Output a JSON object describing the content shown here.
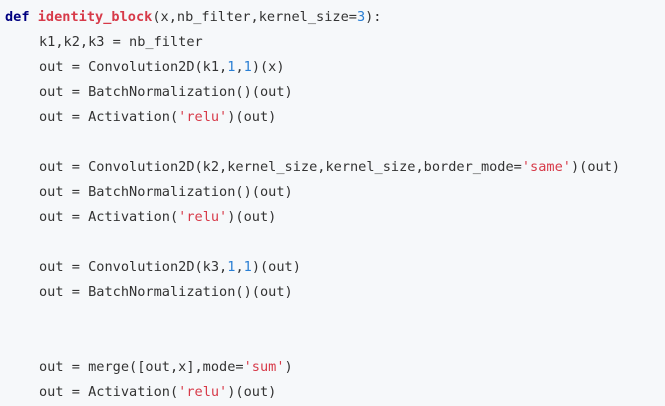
{
  "code": {
    "lines": [
      {
        "indent": false,
        "tokens": [
          {
            "t": "kw",
            "s": "def"
          },
          {
            "t": "plain",
            "s": " "
          },
          {
            "t": "fn",
            "s": "identity_block"
          },
          {
            "t": "plain",
            "s": "(x,nb_filter,kernel_size="
          },
          {
            "t": "num",
            "s": "3"
          },
          {
            "t": "plain",
            "s": "):"
          }
        ]
      },
      {
        "indent": true,
        "tokens": [
          {
            "t": "plain",
            "s": "k1,k2,k3 = nb_filter"
          }
        ]
      },
      {
        "indent": true,
        "tokens": [
          {
            "t": "plain",
            "s": "out = Convolution2D(k1,"
          },
          {
            "t": "num",
            "s": "1"
          },
          {
            "t": "plain",
            "s": ","
          },
          {
            "t": "num",
            "s": "1"
          },
          {
            "t": "plain",
            "s": ")(x)"
          }
        ]
      },
      {
        "indent": true,
        "tokens": [
          {
            "t": "plain",
            "s": "out = BatchNormalization()(out)"
          }
        ]
      },
      {
        "indent": true,
        "tokens": [
          {
            "t": "plain",
            "s": "out = Activation("
          },
          {
            "t": "str",
            "s": "'relu'"
          },
          {
            "t": "plain",
            "s": ")(out)"
          }
        ]
      },
      {
        "indent": true,
        "tokens": []
      },
      {
        "indent": true,
        "tokens": [
          {
            "t": "plain",
            "s": "out = Convolution2D(k2,kernel_size,kernel_size,border_mode="
          },
          {
            "t": "str",
            "s": "'same'"
          },
          {
            "t": "plain",
            "s": ")(out)"
          }
        ]
      },
      {
        "indent": true,
        "tokens": [
          {
            "t": "plain",
            "s": "out = BatchNormalization()(out)"
          }
        ]
      },
      {
        "indent": true,
        "tokens": [
          {
            "t": "plain",
            "s": "out = Activation("
          },
          {
            "t": "str",
            "s": "'relu'"
          },
          {
            "t": "plain",
            "s": ")(out)"
          }
        ]
      },
      {
        "indent": true,
        "tokens": []
      },
      {
        "indent": true,
        "tokens": [
          {
            "t": "plain",
            "s": "out = Convolution2D(k3,"
          },
          {
            "t": "num",
            "s": "1"
          },
          {
            "t": "plain",
            "s": ","
          },
          {
            "t": "num",
            "s": "1"
          },
          {
            "t": "plain",
            "s": ")(out)"
          }
        ]
      },
      {
        "indent": true,
        "tokens": [
          {
            "t": "plain",
            "s": "out = BatchNormalization()(out)"
          }
        ]
      },
      {
        "indent": true,
        "tokens": []
      },
      {
        "indent": true,
        "tokens": []
      },
      {
        "indent": true,
        "tokens": [
          {
            "t": "plain",
            "s": "out = merge([out,x],mode="
          },
          {
            "t": "str",
            "s": "'sum'"
          },
          {
            "t": "plain",
            "s": ")"
          }
        ]
      },
      {
        "indent": true,
        "tokens": [
          {
            "t": "plain",
            "s": "out = Activation("
          },
          {
            "t": "str",
            "s": "'relu'"
          },
          {
            "t": "plain",
            "s": ")(out)"
          }
        ]
      }
    ]
  },
  "colors": {
    "background": "#f6f8fa",
    "keyword": "#000080",
    "function_name": "#d73a49",
    "number": "#2a7fd4",
    "string": "#d73a49",
    "plain": "#333333"
  }
}
